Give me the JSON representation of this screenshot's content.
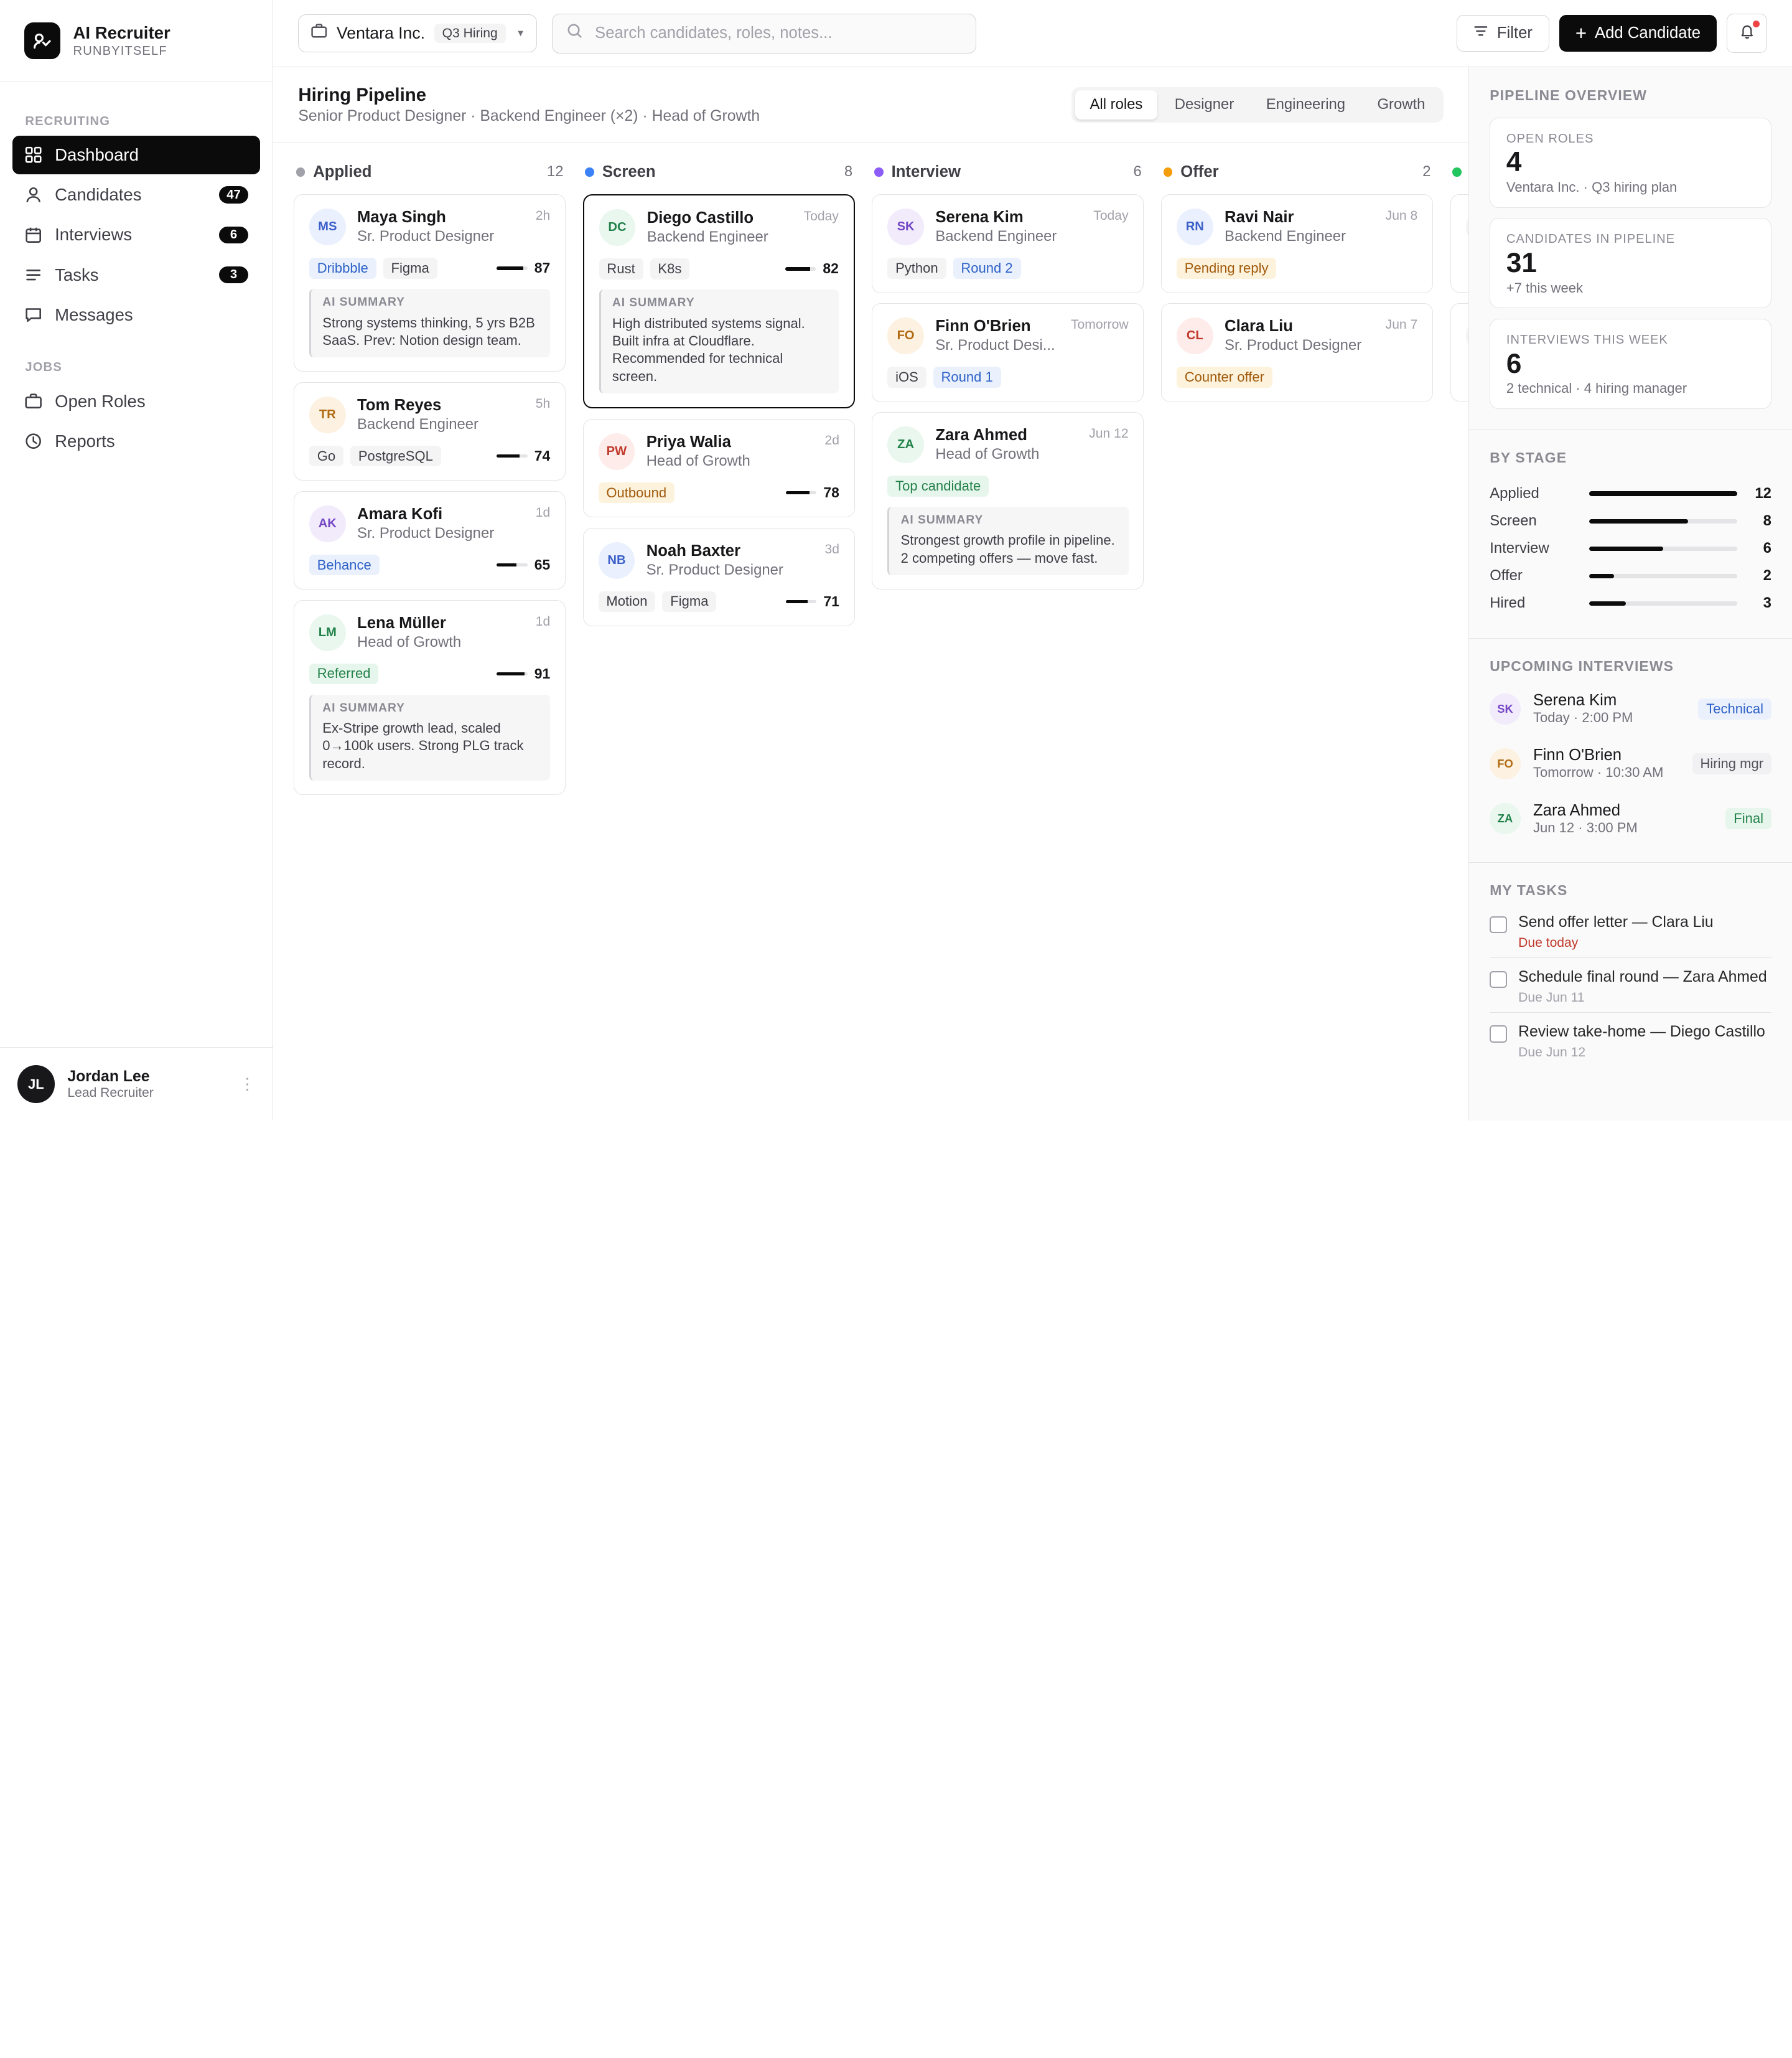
{
  "brand": {
    "title": "AI Recruiter",
    "subtitle": "RUNBYITSELF"
  },
  "sidebar": {
    "sections": [
      {
        "label": "Recruiting",
        "items": [
          {
            "label": "Dashboard",
            "icon": "grid-icon",
            "active": true,
            "count": ""
          },
          {
            "label": "Candidates",
            "icon": "user-icon",
            "count": "47"
          },
          {
            "label": "Interviews",
            "icon": "calendar-icon",
            "count": "6"
          },
          {
            "label": "Tasks",
            "icon": "list-icon",
            "count": "3"
          },
          {
            "label": "Messages",
            "icon": "message-icon",
            "count": ""
          }
        ]
      },
      {
        "label": "Jobs",
        "items": [
          {
            "label": "Open Roles",
            "icon": "briefcase-icon",
            "count": ""
          },
          {
            "label": "Reports",
            "icon": "clock-icon",
            "count": ""
          }
        ]
      }
    ],
    "user": {
      "initials": "JL",
      "name": "Jordan Lee",
      "role": "Lead Recruiter"
    }
  },
  "topbar": {
    "company": "Ventara Inc.",
    "company_tag": "Q3 Hiring",
    "search_placeholder": "Search candidates, roles, notes...",
    "filter_label": "Filter",
    "add_label": "Add Candidate"
  },
  "pipeline": {
    "title": "Hiring Pipeline",
    "subtitle": "Senior Product Designer · Backend Engineer (×2) · Head of Growth",
    "filters": [
      "All roles",
      "Designer",
      "Engineering",
      "Growth"
    ],
    "active_filter": "All roles",
    "columns": [
      {
        "name": "Applied",
        "count": "12",
        "color": "#a1a1aa",
        "cards": [
          {
            "initials": "MS",
            "name": "Maya Singh",
            "role": "Sr. Product Designer",
            "time": "2h",
            "av_bg": "#eaf0fd",
            "av_fg": "#3b5fc9",
            "tags": [
              {
                "text": "Dribbble",
                "style": "blue"
              },
              {
                "text": "Figma",
                "style": "gray"
              }
            ],
            "score": 87,
            "summary": "Strong systems thinking, 5 yrs B2B SaaS. Prev: Notion design team."
          },
          {
            "initials": "TR",
            "name": "Tom Reyes",
            "role": "Backend Engineer",
            "time": "5h",
            "av_bg": "#fdf1e1",
            "av_fg": "#b06a12",
            "tags": [
              {
                "text": "Go",
                "style": "gray"
              },
              {
                "text": "PostgreSQL",
                "style": "gray"
              }
            ],
            "score": 74,
            "summary": ""
          },
          {
            "initials": "AK",
            "name": "Amara Kofi",
            "role": "Sr. Product Designer",
            "time": "1d",
            "av_bg": "#f1ebfc",
            "av_fg": "#7446c4",
            "tags": [
              {
                "text": "Behance",
                "style": "blue"
              }
            ],
            "score": 65,
            "summary": ""
          },
          {
            "initials": "LM",
            "name": "Lena Müller",
            "role": "Head of Growth",
            "time": "1d",
            "av_bg": "#e9f7ee",
            "av_fg": "#23824a",
            "tags": [
              {
                "text": "Referred",
                "style": "green"
              }
            ],
            "score": 91,
            "summary": "Ex-Stripe growth lead, scaled 0→100k users. Strong PLG track record."
          }
        ]
      },
      {
        "name": "Screen",
        "count": "8",
        "color": "#3b82f6",
        "cards": [
          {
            "initials": "DC",
            "name": "Diego Castillo",
            "role": "Backend Engineer",
            "time": "Today",
            "av_bg": "#e9f7ee",
            "av_fg": "#23824a",
            "selected": true,
            "tags": [
              {
                "text": "Rust",
                "style": "gray"
              },
              {
                "text": "K8s",
                "style": "gray"
              }
            ],
            "score": 82,
            "summary": "High distributed systems signal. Built infra at Cloudflare. Recommended for technical screen."
          },
          {
            "initials": "PW",
            "name": "Priya Walia",
            "role": "Head of Growth",
            "time": "2d",
            "av_bg": "#fdecea",
            "av_fg": "#c0392b",
            "tags": [
              {
                "text": "Outbound",
                "style": "amber"
              }
            ],
            "score": 78,
            "summary": ""
          },
          {
            "initials": "NB",
            "name": "Noah Baxter",
            "role": "Sr. Product Designer",
            "time": "3d",
            "av_bg": "#eaf0fd",
            "av_fg": "#3b5fc9",
            "tags": [
              {
                "text": "Motion",
                "style": "gray"
              },
              {
                "text": "Figma",
                "style": "gray"
              }
            ],
            "score": 71,
            "summary": ""
          }
        ]
      },
      {
        "name": "Interview",
        "count": "6",
        "color": "#8b5cf6",
        "cards": [
          {
            "initials": "SK",
            "name": "Serena Kim",
            "role": "Backend Engineer",
            "time": "Today",
            "av_bg": "#f1ebfc",
            "av_fg": "#7446c4",
            "tags": [
              {
                "text": "Python",
                "style": "gray"
              },
              {
                "text": "Round 2",
                "style": "blue"
              }
            ],
            "score": null,
            "summary": ""
          },
          {
            "initials": "FO",
            "name": "Finn O'Brien",
            "role": "Sr. Product Desi...",
            "time": "Tomorrow",
            "av_bg": "#fdf1e1",
            "av_fg": "#b06a12",
            "tags": [
              {
                "text": "iOS",
                "style": "gray"
              },
              {
                "text": "Round 1",
                "style": "blue"
              }
            ],
            "score": null,
            "summary": ""
          },
          {
            "initials": "ZA",
            "name": "Zara Ahmed",
            "role": "Head of Growth",
            "time": "Jun 12",
            "av_bg": "#e9f7ee",
            "av_fg": "#23824a",
            "tags": [
              {
                "text": "Top candidate",
                "style": "green"
              }
            ],
            "score": null,
            "summary": "Strongest growth profile in pipeline. 2 competing offers — move fast."
          }
        ]
      },
      {
        "name": "Offer",
        "count": "2",
        "color": "#f59e0b",
        "cards": [
          {
            "initials": "RN",
            "name": "Ravi Nair",
            "role": "Backend Engineer",
            "time": "Jun 8",
            "av_bg": "#eaf0fd",
            "av_fg": "#3b5fc9",
            "tags": [
              {
                "text": "Pending reply",
                "style": "amber"
              }
            ],
            "score": null,
            "summary": ""
          },
          {
            "initials": "CL",
            "name": "Clara Liu",
            "role": "Sr. Product Designer",
            "time": "Jun 7",
            "av_bg": "#fdecea",
            "av_fg": "#c0392b",
            "tags": [
              {
                "text": "Counter offer",
                "style": "amber"
              }
            ],
            "score": null,
            "summary": ""
          }
        ]
      },
      {
        "name": "",
        "count": "",
        "color": "#22c55e",
        "cards": [
          {
            "initials": "",
            "name": "",
            "role": "",
            "time": "",
            "av_bg": "#f4f4f5",
            "av_fg": "#f4f4f5",
            "tags": [],
            "score": null,
            "summary": ""
          },
          {
            "initials": "",
            "name": "",
            "role": "",
            "time": "",
            "av_bg": "#f4f4f5",
            "av_fg": "#f4f4f5",
            "tags": [],
            "score": null,
            "summary": ""
          }
        ]
      }
    ]
  },
  "overview": {
    "title": "Pipeline Overview",
    "stats": [
      {
        "label": "Open Roles",
        "value": "4",
        "sub": "Ventara Inc. · Q3 hiring plan"
      },
      {
        "label": "Candidates in Pipeline",
        "value": "31",
        "sub": "+7 this week"
      },
      {
        "label": "Interviews this week",
        "value": "6",
        "sub": "2 technical · 4 hiring manager"
      }
    ]
  },
  "by_stage": {
    "title": "By Stage",
    "max": 12,
    "rows": [
      {
        "name": "Applied",
        "value": 12
      },
      {
        "name": "Screen",
        "value": 8
      },
      {
        "name": "Interview",
        "value": 6
      },
      {
        "name": "Offer",
        "value": 2
      },
      {
        "name": "Hired",
        "value": 3
      }
    ]
  },
  "upcoming": {
    "title": "Upcoming Interviews",
    "items": [
      {
        "initials": "SK",
        "name": "Serena Kim",
        "time": "Today · 2:00 PM",
        "tag": "Technical",
        "av_bg": "#f1ebfc",
        "av_fg": "#7446c4",
        "tag_bg": "#eaf1fd",
        "tag_fg": "#2e62c8"
      },
      {
        "initials": "FO",
        "name": "Finn O'Brien",
        "time": "Tomorrow · 10:30 AM",
        "tag": "Hiring mgr",
        "av_bg": "#fdf1e1",
        "av_fg": "#b06a12",
        "tag_bg": "#f1f1f3",
        "tag_fg": "#52525b"
      },
      {
        "initials": "ZA",
        "name": "Zara Ahmed",
        "time": "Jun 12 · 3:00 PM",
        "tag": "Final",
        "av_bg": "#e9f7ee",
        "av_fg": "#23824a",
        "tag_bg": "#e7f6ec",
        "tag_fg": "#23824a"
      }
    ]
  },
  "tasks": {
    "title": "My Tasks",
    "items": [
      {
        "title": "Send offer letter — Clara Liu",
        "due": "Due today",
        "urgent": true
      },
      {
        "title": "Schedule final round — Zara Ahmed",
        "due": "Due Jun 11",
        "urgent": false
      },
      {
        "title": "Review take-home — Diego Castillo",
        "due": "Due Jun 12",
        "urgent": false
      }
    ]
  }
}
